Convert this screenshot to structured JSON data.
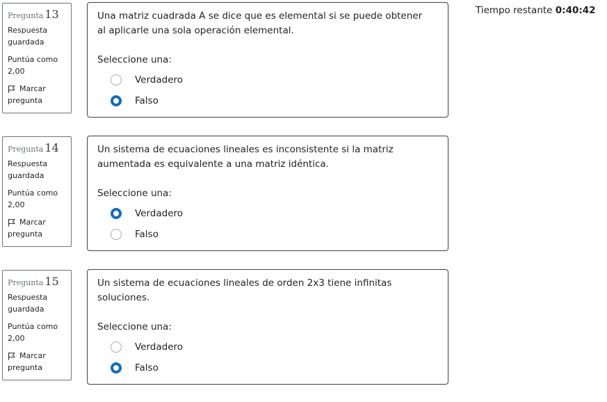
{
  "timer": {
    "label": "Tiempo restante",
    "value": "0:40:42"
  },
  "questions": [
    {
      "label": "Pregunta",
      "number": "13",
      "state_line1": "Respuesta",
      "state_line2": "guardada",
      "grade_line1": "Puntúa como",
      "grade_line2": "2,00",
      "flag_line1": "Marcar",
      "flag_line2": "pregunta",
      "text": "Una matriz cuadrada A se dice que es elemental si se puede obtener al aplicarle una sola operación elemental.",
      "prompt": "Seleccione una:",
      "options": [
        {
          "label": "Verdadero",
          "selected": false
        },
        {
          "label": "Falso",
          "selected": true
        }
      ]
    },
    {
      "label": "Pregunta",
      "number": "14",
      "state_line1": "Respuesta",
      "state_line2": "guardada",
      "grade_line1": "Puntúa como",
      "grade_line2": "2,00",
      "flag_line1": "Marcar",
      "flag_line2": "pregunta",
      "text": "Un sistema de ecuaciones lineales es inconsistente si la matriz aumentada es equivalente a una matriz idéntica.",
      "prompt": "Seleccione una:",
      "options": [
        {
          "label": "Verdadero",
          "selected": true
        },
        {
          "label": "Falso",
          "selected": false
        }
      ]
    },
    {
      "label": "Pregunta",
      "number": "15",
      "state_line1": "Respuesta",
      "state_line2": "guardada",
      "grade_line1": "Puntúa como",
      "grade_line2": "2,00",
      "flag_line1": "Marcar",
      "flag_line2": "pregunta",
      "text": "Un sistema de ecuaciones lineales de orden 2x3 tiene infinitas soluciones.",
      "prompt": "Seleccione una:",
      "options": [
        {
          "label": "Verdadero",
          "selected": false
        },
        {
          "label": "Falso",
          "selected": true
        }
      ]
    }
  ],
  "colors": {
    "accent": "#0f6cbf",
    "border": "#3c4046",
    "muted": "#6a737b"
  },
  "icons": {
    "flag": "flag-icon"
  }
}
